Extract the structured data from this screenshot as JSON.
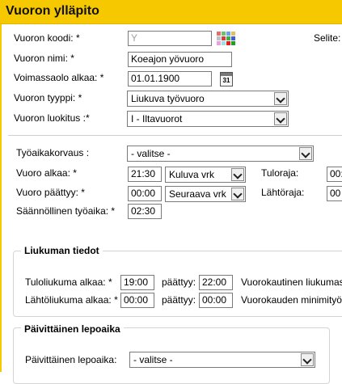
{
  "header": {
    "title": "Vuoron ylläpito"
  },
  "form": {
    "koodi_label": "Vuoron koodi: *",
    "koodi_value": "Y",
    "selite_label": "Selite:",
    "nimi_label": "Vuoron nimi: *",
    "nimi_value": "Koeajon yövuoro",
    "voimassa_label": "Voimassaolo alkaa: *",
    "voimassa_value": "01.01.1900",
    "calendar_text": "31",
    "tyyppi_label": "Vuoron tyyppi: *",
    "tyyppi_value": "Liukuva työvuoro",
    "luokitus_label": "Vuoron luokitus :*",
    "luokitus_value": "I - Iltavuorot"
  },
  "worktime": {
    "korvaus_label": "Työaikakorvaus :",
    "korvaus_value": "- valitse -",
    "alkaa_label": "Vuoro alkaa: *",
    "alkaa_time": "21:30",
    "alkaa_day": "Kuluva vrk",
    "tuloraja_label": "Tuloraja:",
    "tuloraja_value": "00:",
    "paattyy_label": "Vuoro päättyy: *",
    "paattyy_time": "00:00",
    "paattyy_day": "Seuraava vrk",
    "lahtoraja_label": "Lähtöraja:",
    "lahtoraja_value": "00",
    "saannollinen_label": "Säännöllinen työaika: *",
    "saannollinen_value": "02:30"
  },
  "liukuma": {
    "legend": "Liukuman tiedot",
    "tulo_label": "Tuloliukuma alkaa: *",
    "tulo_alkaa": "19:00",
    "paattyy_label_1": "päättyy:",
    "tulo_paattyy": "22:00",
    "vuorokautinen_label": "Vuorokautinen liukumas",
    "lahto_label": "Lähtöliukuma alkaa: *",
    "lahto_alkaa": "00:00",
    "paattyy_label_2": "päättyy:",
    "lahto_paattyy": "00:00",
    "minimi_label": "Vuorokauden minimityö"
  },
  "lepoaika": {
    "legend": "Päivittäinen lepoaika",
    "label": "Päivittäinen lepoaika:",
    "value": "- valitse -"
  }
}
